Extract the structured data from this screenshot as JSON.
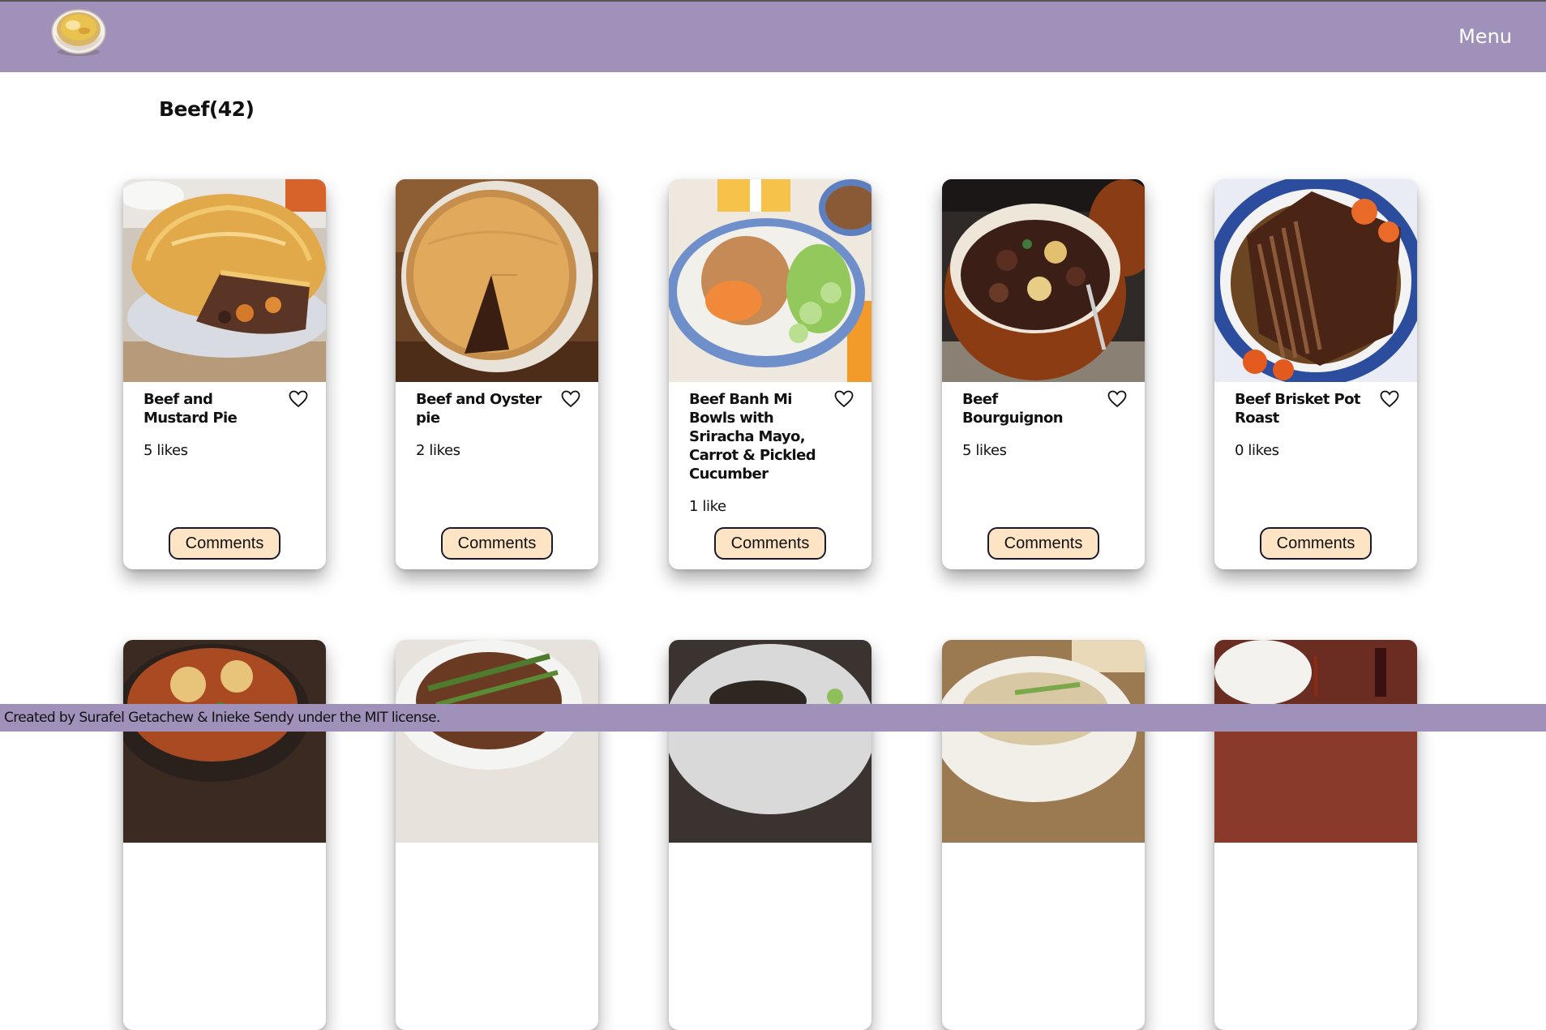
{
  "navbar": {
    "menu_label": "Menu",
    "logo_icon": "soup-bowl-icon",
    "background": "#a091bb"
  },
  "category": {
    "title": "Beef(42)"
  },
  "meals": [
    {
      "name": "Beef and Mustard Pie",
      "likes": "5 likes",
      "comments_label": "Comments",
      "image": "beef-mustard-pie"
    },
    {
      "name": "Beef and Oyster pie",
      "likes": "2 likes",
      "comments_label": "Comments",
      "image": "beef-oyster-pie"
    },
    {
      "name": "Beef Banh Mi Bowls with Sriracha Mayo, Carrot & Pickled Cucumber",
      "likes": "1 like",
      "comments_label": "Comments",
      "image": "banh-mi-bowl"
    },
    {
      "name": "Beef Bourguignon",
      "likes": "5 likes",
      "comments_label": "Comments",
      "image": "beef-bourguignon"
    },
    {
      "name": "Beef Brisket Pot Roast",
      "likes": "0 likes",
      "comments_label": "Comments",
      "image": "brisket-pot-roast"
    }
  ],
  "footer": {
    "text": "Created by Surafel Getachew & Inieke Sendy under the MIT license."
  },
  "colors": {
    "accent": "#a091bb",
    "button_bg": "#fde4c4",
    "button_border": "#1a1a2e"
  }
}
